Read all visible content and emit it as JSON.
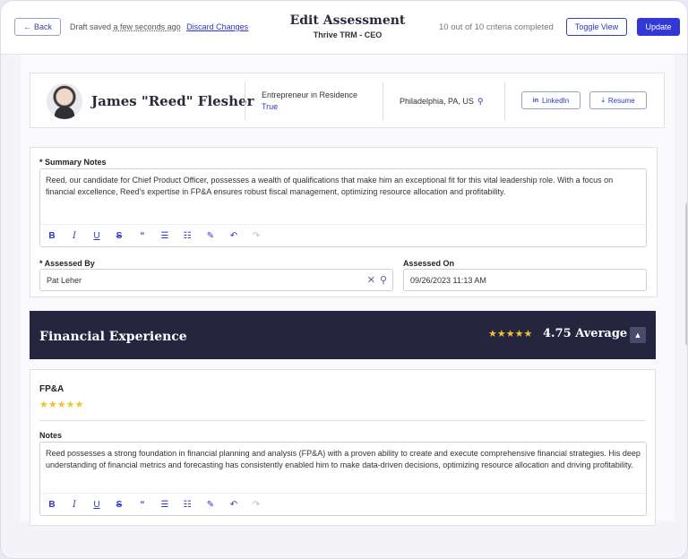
{
  "header": {
    "back_label": "Back",
    "draft_prefix": "Draft saved",
    "draft_time": "a few seconds ago",
    "discard_label": "Discard Changes",
    "title": "Edit Assessment",
    "subtitle": "Thrive TRM - CEO",
    "criteria_status": "10 out of 10 criteria completed",
    "toggle_label": "Toggle View",
    "update_label": "Update"
  },
  "profile": {
    "name": "James \"Reed\" Flesher",
    "role": "Entrepreneur in Residence",
    "role_value": "True",
    "location": "Philadelphia, PA, US",
    "linkedin_label": "LinkedIn",
    "resume_label": "Resume"
  },
  "summary": {
    "label": "* Summary Notes",
    "text": "Reed, our candidate for Chief Product Officer, possesses a wealth of qualifications that make him an exceptional fit for this vital leadership role. With a focus on financial excellence, Reed's expertise in FP&A ensures robust fiscal management, optimizing resource allocation and profitability.",
    "assessed_by_label": "* Assessed By",
    "assessed_by_value": "Pat Leher",
    "assessed_on_label": "Assessed On",
    "assessed_on_value": "09/26/2023 11:13 AM"
  },
  "toolbar": {
    "bold": "B",
    "italic": "I",
    "underline": "U",
    "strike": "S",
    "quote": "“",
    "bullets": "☰",
    "numbered": "☷",
    "clear": "✎",
    "undo": "↶",
    "redo": "↷"
  },
  "section": {
    "title": "Financial Experience",
    "stars": "★★★★★",
    "average": "4.75 Average",
    "collapse_icon": "chevron-up-icon"
  },
  "criterion": {
    "title": "FP&A",
    "stars": "★★★★★",
    "rating": 5,
    "notes_label": "Notes",
    "notes_text": "Reed possesses a strong foundation in financial planning and analysis (FP&A) with a proven ability to create and execute comprehensive financial strategies. His deep understanding of financial metrics and forecasting has consistently enabled him to make data-driven decisions, optimizing resource allocation and driving profitability."
  },
  "colors": {
    "accent": "#3138d6",
    "banner": "#25253f",
    "star": "#f1c232"
  }
}
